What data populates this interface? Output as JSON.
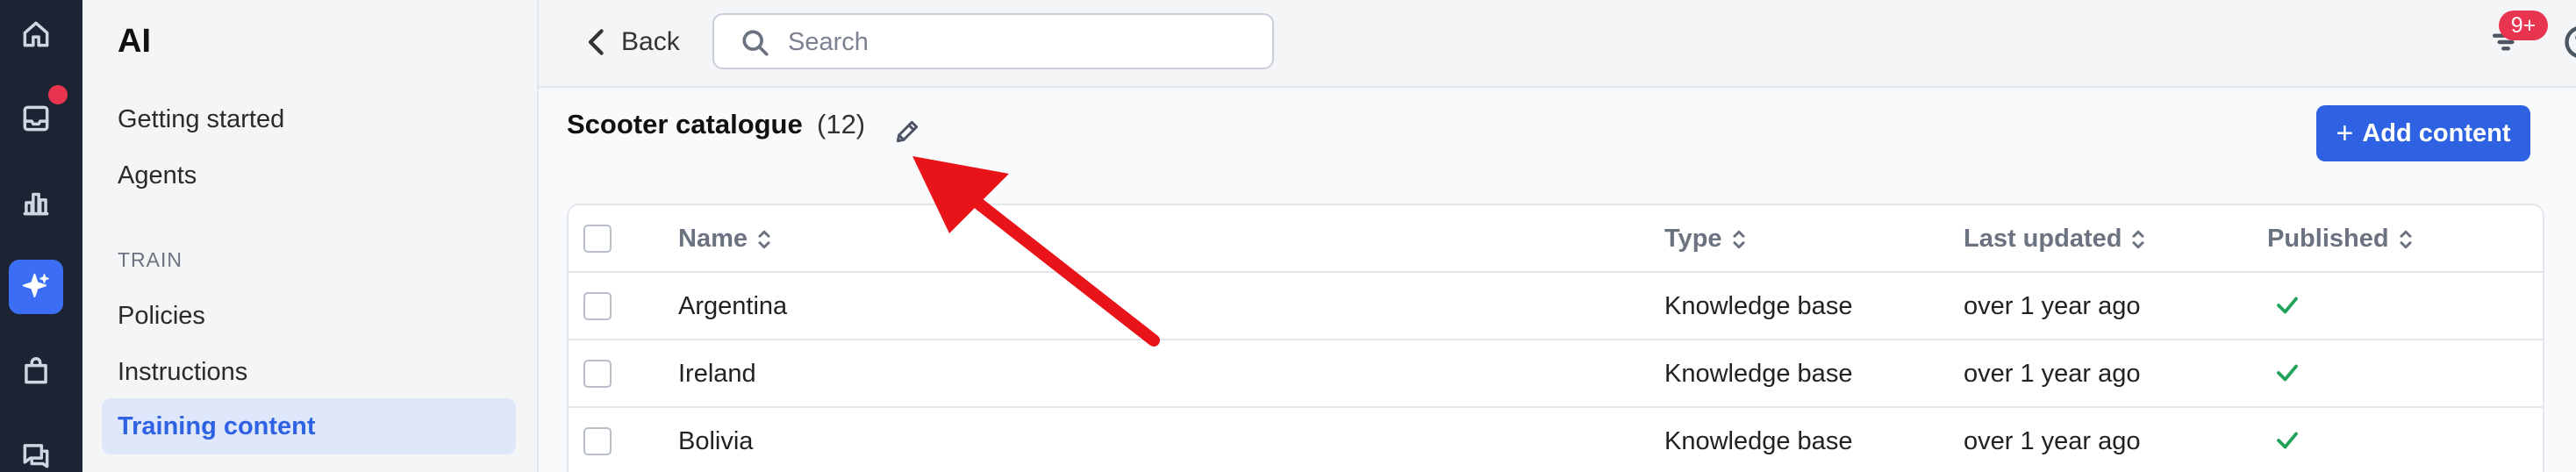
{
  "rail": {
    "items": [
      {
        "icon": "home-icon"
      },
      {
        "icon": "inbox-icon",
        "has_notification_dot": true
      },
      {
        "icon": "reports-icon"
      },
      {
        "icon": "ai-sparkle-icon",
        "active": true
      },
      {
        "icon": "shopping-bag-icon"
      },
      {
        "icon": "messages-icon"
      }
    ],
    "accent": "#3b6ef5",
    "dot_color": "#e8344e"
  },
  "sidebar": {
    "title": "AI",
    "items": [
      {
        "label": "Getting started"
      },
      {
        "label": "Agents"
      }
    ],
    "section_label": "TRAIN",
    "train_items": [
      {
        "label": "Policies"
      },
      {
        "label": "Instructions"
      },
      {
        "label": "Training content",
        "active": true
      }
    ]
  },
  "topbar": {
    "back_label": "Back",
    "search_placeholder": "Search",
    "notification_badge": "9+",
    "icons": [
      "filter-icon",
      "help-icon",
      "bell-icon"
    ]
  },
  "main": {
    "title": "Scooter catalogue",
    "count": "(12)",
    "add_button_label": "Add content",
    "add_button_icon": "plus-icon",
    "accent": "#2f62e3"
  },
  "table": {
    "columns": [
      "Name",
      "Type",
      "Last updated",
      "Published"
    ],
    "rows": [
      {
        "name": "Argentina",
        "type": "Knowledge base",
        "updated": "over 1 year ago",
        "published": true
      },
      {
        "name": "Ireland",
        "type": "Knowledge base",
        "updated": "over 1 year ago",
        "published": true
      },
      {
        "name": "Bolivia",
        "type": "Knowledge base",
        "updated": "over 1 year ago",
        "published": true
      }
    ],
    "published_color": "#22a35a"
  },
  "annotation": {
    "type": "arrow",
    "color": "#e8141a",
    "points_to": "edit-title-pencil-icon"
  }
}
